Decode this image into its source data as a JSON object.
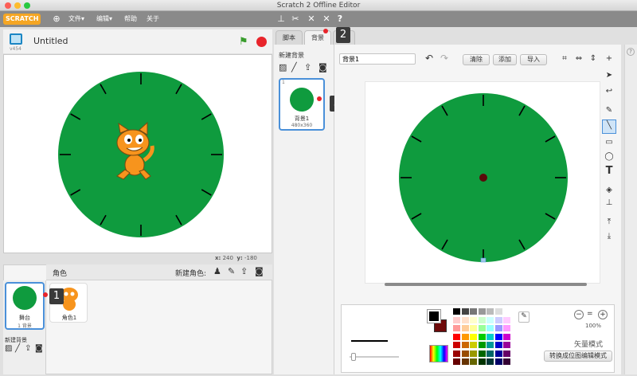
{
  "window": {
    "title": "Scratch 2 Offline Editor"
  },
  "menu": {
    "logo": "SCRATCH",
    "file": "文件▾",
    "edit": "编辑▾",
    "help": "帮助",
    "about": "关于"
  },
  "stage": {
    "project_title": "Untitled",
    "version": "v454",
    "coord_x_label": "x:",
    "coord_x": "240",
    "coord_y_label": "y:",
    "coord_y": "-180"
  },
  "sprites": {
    "header": "角色",
    "new_sprite_label": "新建角色:",
    "stage_label": "舞台",
    "stage_sub": "1 背景",
    "new_backdrop_label": "新建背景",
    "sprite1_name": "角色1"
  },
  "tabs": {
    "scripts": "脚本",
    "backdrops": "背景"
  },
  "backdrops": {
    "new_label": "新建背景",
    "item_index": "1",
    "item_name": "背景1",
    "item_size": "480x360"
  },
  "editor": {
    "name_value": "背景1",
    "clear": "清除",
    "add": "添加",
    "import": "导入",
    "zoom": "100%",
    "mode_label": "矢量模式",
    "convert_button": "转换成位图编辑模式"
  },
  "callouts": {
    "c1": "1",
    "c2": "2",
    "c3": "3"
  },
  "colors": {
    "accent": "#f5a623",
    "green": "#0f9b3e",
    "selection": "#4a90d9",
    "red_dot": "#e8242b"
  }
}
